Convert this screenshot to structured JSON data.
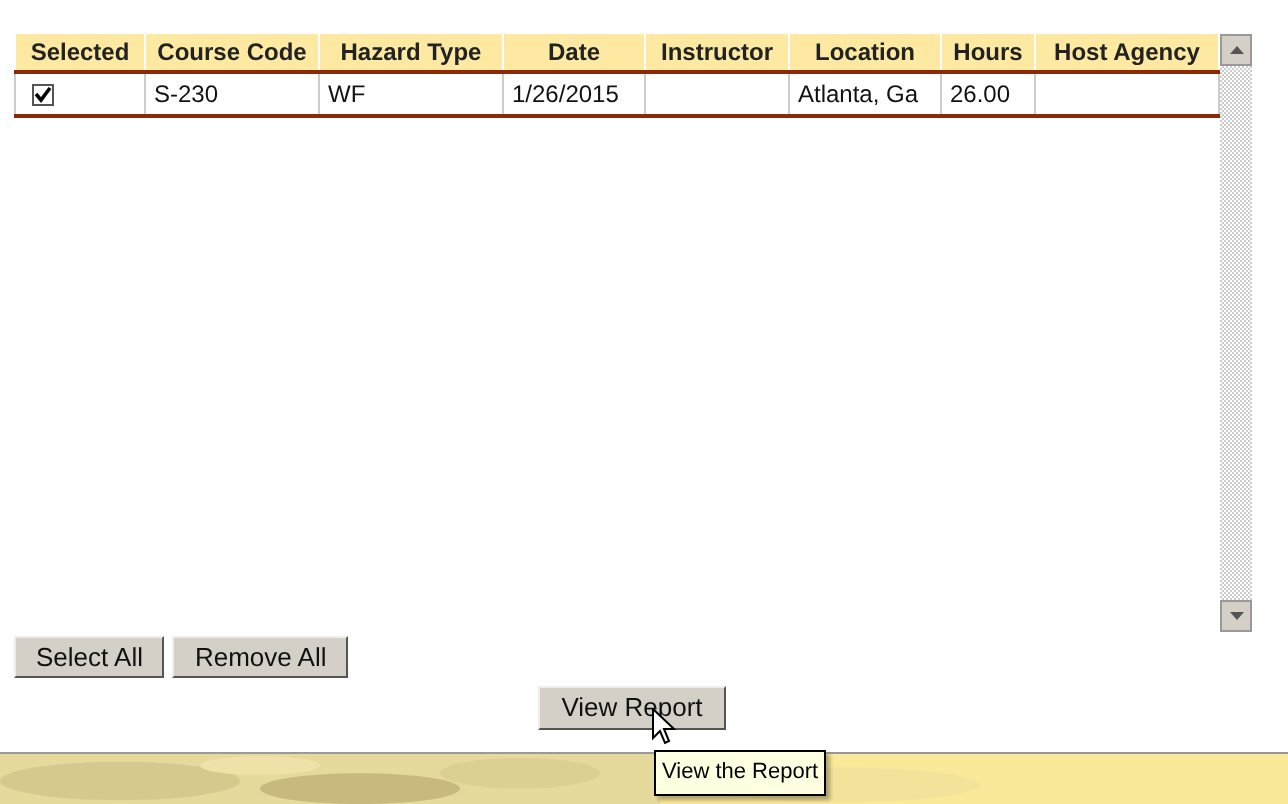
{
  "table": {
    "columns": [
      "Selected",
      "Course Code",
      "Hazard Type",
      "Date",
      "Instructor",
      "Location",
      "Hours",
      "Host Agency"
    ],
    "rows": [
      {
        "cells": [
          {
            "kind": "checkbox",
            "checked": true
          },
          {
            "kind": "text",
            "text": "S-230"
          },
          {
            "kind": "text",
            "text": "WF"
          },
          {
            "kind": "text",
            "text": "1/26/2015"
          },
          {
            "kind": "text",
            "text": ""
          },
          {
            "kind": "text",
            "text": "Atlanta, Ga"
          },
          {
            "kind": "text",
            "text": "26.00"
          },
          {
            "kind": "text",
            "text": ""
          }
        ]
      }
    ]
  },
  "buttons": [
    "Select All",
    "Remove All"
  ],
  "report_button": "View Report",
  "tooltip": "View the Report"
}
